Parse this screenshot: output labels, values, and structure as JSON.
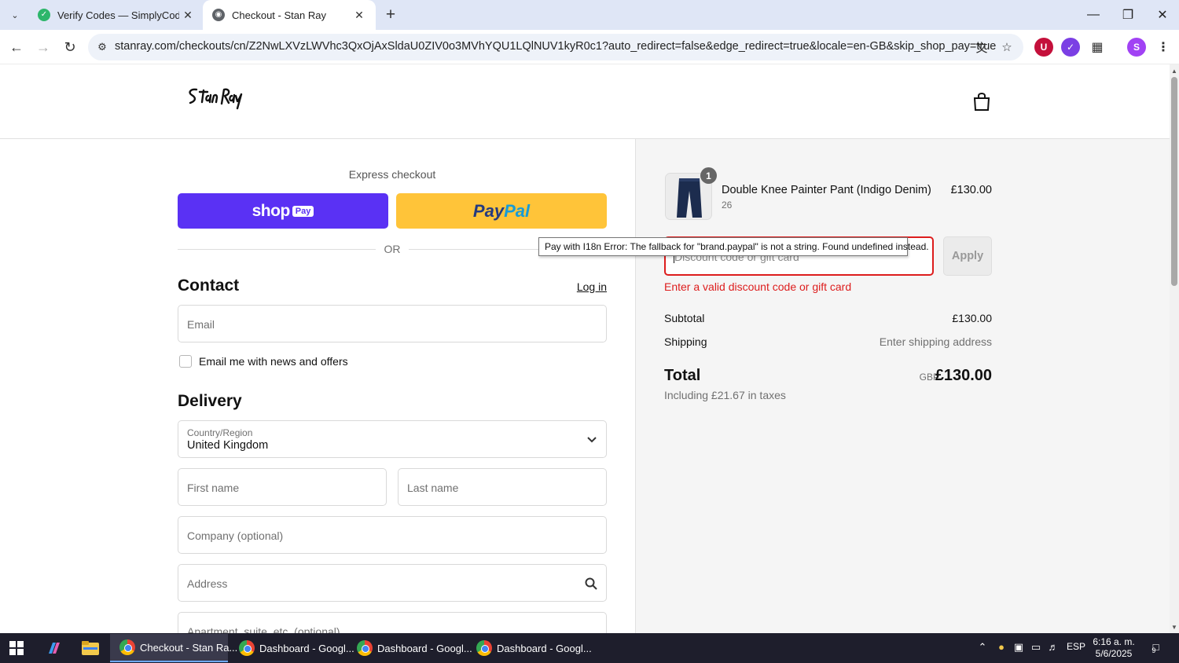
{
  "browser": {
    "tabs": [
      {
        "title": "Verify Codes — SimplyCodes",
        "favicon": "simplycodes-icon",
        "active": false
      },
      {
        "title": "Checkout - Stan Ray",
        "favicon": "globe-icon",
        "active": true
      }
    ],
    "url": "stanray.com/checkouts/cn/Z2NwLXVzLWVhc3QxOjAxSldaU0ZIV0o3MVhYQU1LQlNUV1kyR0c1?auto_redirect=false&edge_redirect=true&locale=en-GB&skip_shop_pay=true",
    "profile_initial": "S"
  },
  "checkout": {
    "express_title": "Express checkout",
    "shop_pay_label": "shop",
    "shop_pay_badge": "Pay",
    "paypal_label_1": "Pay",
    "paypal_label_2": "Pal",
    "or_text": "OR",
    "contact_heading": "Contact",
    "login_link": "Log in",
    "email_placeholder": "Email",
    "newsletter_label": "Email me with news and offers",
    "delivery_heading": "Delivery",
    "country_label": "Country/Region",
    "country_value": "United Kingdom",
    "first_name_placeholder": "First name",
    "last_name_placeholder": "Last name",
    "company_placeholder": "Company (optional)",
    "address_placeholder": "Address",
    "apartment_placeholder": "Apartment, suite, etc. (optional)"
  },
  "summary": {
    "product_name": "Double Knee Painter Pant (Indigo Denim)",
    "product_variant": "26",
    "product_qty": "1",
    "product_price": "£130.00",
    "discount_placeholder": "Discount code or gift card",
    "apply_label": "Apply",
    "discount_error": "Enter a valid discount code or gift card",
    "subtotal_label": "Subtotal",
    "subtotal_value": "£130.00",
    "shipping_label": "Shipping",
    "shipping_value": "Enter shipping address",
    "total_label": "Total",
    "currency": "GBP",
    "total_value": "£130.00",
    "tax_note": "Including £21.67 in taxes"
  },
  "tooltip": {
    "text": "Pay with I18n Error: The fallback for \"brand.paypal\" is not a string. Found undefined instead."
  },
  "taskbar": {
    "apps": [
      {
        "label": "Checkout - Stan Ra...",
        "active": true
      },
      {
        "label": "Dashboard - Googl...",
        "active": false
      },
      {
        "label": "Dashboard - Googl...",
        "active": false
      },
      {
        "label": "Dashboard - Googl...",
        "active": false
      }
    ],
    "language": "ESP",
    "time": "6:16 a. m.",
    "date": "5/6/2025",
    "notifications": "9"
  },
  "colors": {
    "shop_pay": "#5a31f4",
    "paypal": "#ffc439",
    "error": "#dd1d1d"
  }
}
